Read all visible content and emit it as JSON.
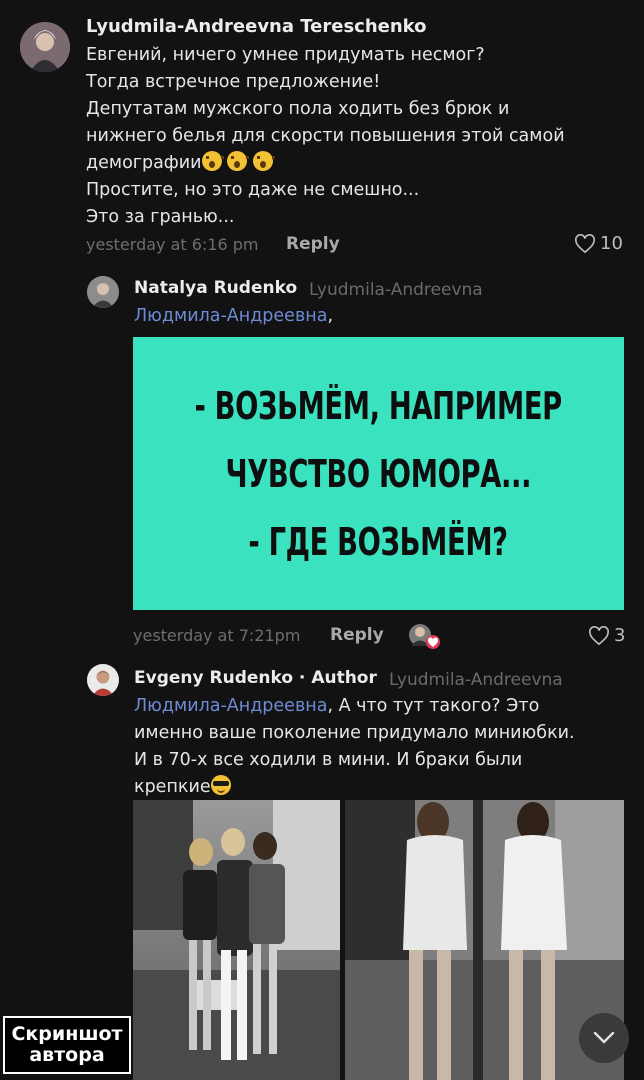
{
  "comments": [
    {
      "author": "Lyudmila-Andreevna Tereschenko",
      "lines": [
        "Евгений, ничего умнее придумать несмог?",
        "Тогда встречное предложение!",
        "Депутатам мужского пола ходить без брюк и",
        "нижнего белья для скорсти повышения этой самой",
        "демографии",
        "Простите, но это даже не смешно...",
        "Это за гранью..."
      ],
      "timestamp": "yesterday at 6:16 pm",
      "reply_label": "Reply",
      "likes": "10"
    },
    {
      "author": "Natalya Rudenko",
      "reply_to": "Lyudmila-Andreevna",
      "mention": "Людмила-Андреевна",
      "mention_suffix": ",",
      "meme_lines": [
        "- ВОЗЬМЁМ, НАПРИМЕР",
        "ЧУВСТВО ЮМОРА...",
        "- ГДЕ ВОЗЬМЁМ?"
      ],
      "timestamp": "yesterday at 7:21pm",
      "reply_label": "Reply",
      "likes": "3"
    },
    {
      "author": "Evgeny Rudenko · Author",
      "reply_to": "Lyudmila-Andreevna",
      "mention": "Людмила-Андреевна",
      "lines": [
        ", А что тут такого? Это",
        "именно ваше поколение придумало миниюбки.",
        "И в 70-х все ходили в мини. И браки были",
        "крепкие"
      ]
    }
  ],
  "watermark": [
    "Скриншот",
    "автора"
  ],
  "icons": {
    "heart": "heart-icon",
    "scroll_down": "chevron-down-icon",
    "reaction": "love-reaction-icon"
  },
  "colors": {
    "background": "#121212",
    "mention": "#6f8bd6",
    "meme_bg": "#3ae2c0"
  }
}
